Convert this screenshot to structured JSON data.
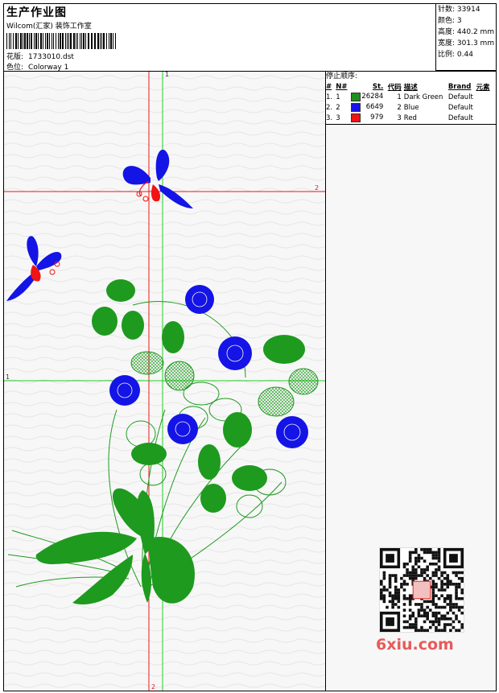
{
  "header": {
    "title": "生产作业图",
    "company": "Wilcom(汇家) 装饰工作室",
    "pattern_label": "花版:",
    "pattern_value": "1733010.dst",
    "colorway_label": "色位:",
    "colorway_value": "Colorway 1"
  },
  "stats": {
    "stitches_label": "针数:",
    "stitches_value": "33914",
    "colors_label": "颜色:",
    "colors_value": "3",
    "height_label": "高度:",
    "height_value": "440.2 mm",
    "width_label": "宽度:",
    "width_value": "301.3 mm",
    "scale_label": "比例:",
    "scale_value": "0.44"
  },
  "stop_sequence": {
    "title": "停止顺序:",
    "columns": [
      "#",
      "N#",
      "St.",
      "代码",
      "描述",
      "Brand",
      "元素"
    ],
    "rows": [
      {
        "idx": "1.",
        "n": "1",
        "color": "#1e8f1e",
        "st": "26284",
        "code": "1",
        "desc": "Dark Green",
        "brand": "Default"
      },
      {
        "idx": "2.",
        "n": "2",
        "color": "#1414e6",
        "st": "6649",
        "code": "2",
        "desc": "Blue",
        "brand": "Default"
      },
      {
        "idx": "3.",
        "n": "3",
        "color": "#f01414",
        "st": "979",
        "code": "3",
        "desc": "Red",
        "brand": "Default"
      }
    ]
  },
  "guides": {
    "label_1": "1",
    "label_2": "2"
  },
  "watermark": "6xiu.com",
  "colors": {
    "green": "#1e9a1e",
    "blue": "#1414e6",
    "red": "#f01414",
    "guide_red": "#e81818",
    "guide_green": "#22cc22"
  }
}
